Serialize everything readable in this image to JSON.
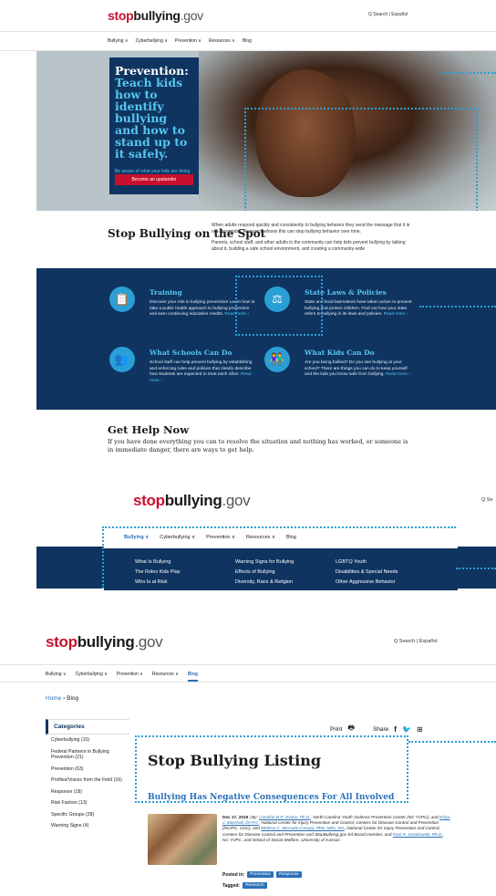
{
  "site": {
    "logo_stop": "stop",
    "logo_bullying": "bullying",
    "logo_gov": ".gov"
  },
  "s1": {
    "utility": "Q Search  |  Español",
    "nav": [
      "Bullying ∨",
      "Cyberbullying ∨",
      "Prevention ∨",
      "Resources ∨",
      "Blog"
    ],
    "hero": {
      "title_line1": "Prevention:",
      "title_rest": "Teach kids how to identify bullying and how to stand up to it safely.",
      "sub": "Be aware of what your kids are doing online",
      "button": "Become an upstander"
    },
    "spot": {
      "title": "Stop Bullying on the Spot",
      "p1": "When adults respond quickly and consistently to bullying behavior they send the message that it is not acceptable. Research shows this can stop bullying behavior over time.",
      "p2": "Parents, school staff, and other adults in the community can help kids prevent bullying by talking about it, building a safe school environment, and creating a community-wide"
    },
    "features": [
      {
        "icon": "clipboard-icon",
        "glyph": "📋",
        "title": "Training",
        "body": "Discover your role in bullying prevention! Learn how to take a public health approach to bullying prevention and earn continuing education credits.",
        "more": "Read more ›"
      },
      {
        "icon": "gavel-icon",
        "glyph": "⚖",
        "title": "State Laws & Policies",
        "body": "State and local lawmakers have taken action to prevent bullying and protect children. Find out how your state refers to bullying in its laws and policies.",
        "more": "Read more ›"
      },
      {
        "icon": "school-group-icon",
        "glyph": "👥",
        "title": "What Schools Can Do",
        "body": "School staff can help prevent bullying by establishing and enforcing rules and policies that clearly describe how students are expected to treat each other.",
        "more": "Read more ›"
      },
      {
        "icon": "kids-icon",
        "glyph": "👫",
        "title": "What Kids Can Do",
        "body": "Are you being bullied? Do you see bullying at your school? There are things you can do to keep yourself and the kids you know safe from bullying.",
        "more": "Read more ›"
      }
    ],
    "gethelp": {
      "title": "Get Help Now",
      "text": "If you have done everything you can to resolve the situation and nothing has worked, or someone is in immediate danger, there are ways to get help."
    }
  },
  "s2": {
    "search": "Q Se",
    "nav": [
      "Bullying ∨",
      "Cyberbullying ∨",
      "Prevention ∨",
      "Resources ∨",
      "Blog"
    ],
    "mega": {
      "col1": [
        "What Is Bullying",
        "The Roles Kids Play",
        "Who Is at Risk"
      ],
      "col2": [
        "Warning Signs for Bullying",
        "Effects of Bullying",
        "Diversity, Race & Religion"
      ],
      "col3": [
        "LGBTQ Youth",
        "Disabilities & Special Needs",
        "Other Aggressive Behavior"
      ]
    }
  },
  "s3": {
    "utility": "Q Search  |  Español",
    "nav": [
      "Bullying ∨",
      "Cyberbullying ∨",
      "Prevention ∨",
      "Resources ∨",
      "Blog"
    ],
    "breadcrumb_home": "Home",
    "breadcrumb_sep": "›",
    "breadcrumb_current": "Blog",
    "categories_title": "Categories",
    "categories": [
      "Cyberbullying (10)",
      "Federal Partners in Bullying Prevention (21)",
      "Prevention (63)",
      "Profiles/Voices from the Field (16)",
      "Response (18)",
      "Risk Factors (13)",
      "Specific Groups (28)",
      "Warning Signs (4)"
    ],
    "print_label": "Print",
    "share_label": "Share",
    "listing_title": "Stop Bullying Listing",
    "post": {
      "title": "Bullying Has Negative Consequences For All Involved",
      "date": "Dec 17, 2018",
      "by": "By:",
      "author1": "Caroline B.R. Evans, Ph.D.",
      "aff1": ", North Carolina Youth Violence Prevention Center (NC YVPC), and ",
      "author2": "Khiya J. Marshall, Dr.P.H.",
      "aff2": ", National Center for Injury Prevention and Control, Centers for Disease Control and Prevention (NCIPC, CDC), and ",
      "author3": "Melissa C. Mercado-Crespo, PhD, MSc, MA",
      "aff3": ", National Center for Injury Prevention and Control, Centers for Disease Control and Prevention and StopBullying.gov Ed Board member, and ",
      "author4": "Paul R. Smokowski, Ph.D.",
      "aff4": ", NC YVPC, and School of Social Welfare, University of Kansas",
      "posted_in_label": "Posted in:",
      "posted_in": [
        "Prevention",
        "Response"
      ],
      "tagged_label": "Tagged:",
      "tagged": [
        "Research"
      ]
    }
  },
  "colors": {
    "navy": "#0f3460",
    "accent_blue": "#2a9fd6",
    "brand_red": "#c8102e",
    "link": "#2a70b8"
  }
}
